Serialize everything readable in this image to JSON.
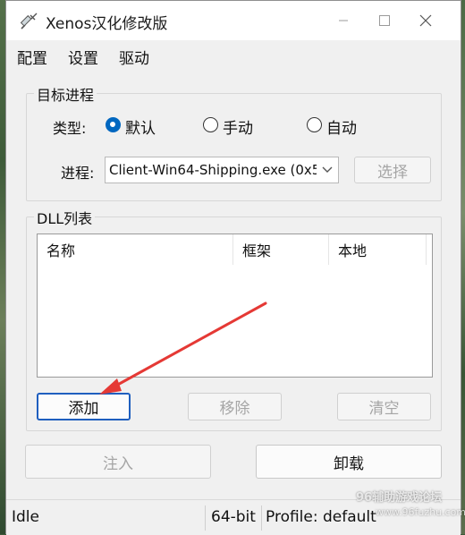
{
  "window": {
    "title": "Xenos汉化修改版"
  },
  "menu": {
    "items": [
      "配置",
      "设置",
      "驱动"
    ]
  },
  "target_group": {
    "legend": "目标进程",
    "type_label": "类型:",
    "radio_default": "默认",
    "radio_manual": "手动",
    "radio_auto": "自动",
    "selected": "默认",
    "process_label": "进程:",
    "process_value": "Client-Win64-Shipping.exe (0x5",
    "select_button": "选择"
  },
  "dll_group": {
    "legend": "DLL列表",
    "columns": [
      "名称",
      "框架",
      "本地"
    ],
    "add_button": "添加",
    "remove_button": "移除",
    "clear_button": "清空"
  },
  "actions": {
    "inject_button": "注入",
    "unload_button": "卸载"
  },
  "status": {
    "state": "Idle",
    "arch": "64-bit",
    "profile": "Profile: default"
  },
  "watermark": {
    "line1": "96辅助游戏论坛",
    "line2": "www.96fuzhu.com"
  },
  "colors": {
    "accent": "#0067c0",
    "arrow": "#e53935",
    "focus_border": "#1f5fbf"
  }
}
